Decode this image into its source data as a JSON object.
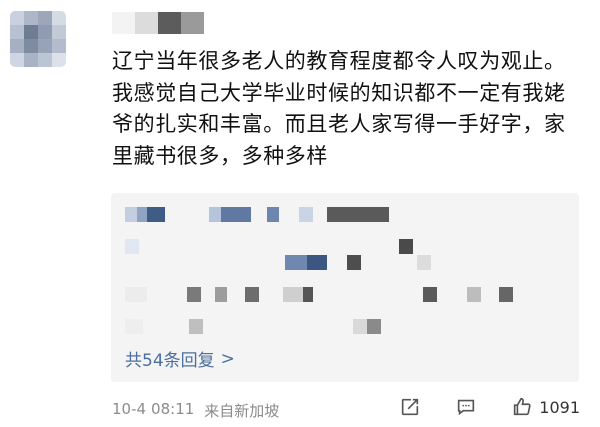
{
  "comment": {
    "text": "辽宁当年很多老人的教育程度都令人叹为观止。我感觉自己大学毕业时候的知识都不一定有我姥爷的扎实和丰富。而且老人家写得一手好字，家里藏书很多，多种多样"
  },
  "replies": {
    "summary": "共54条回复",
    "chevron": ">"
  },
  "footer": {
    "date": "10-4",
    "time": "08:11",
    "location": "来自新加坡",
    "like_count": "1091"
  },
  "icons": {
    "edit": "edit-icon",
    "comment": "comment-icon",
    "like": "thumbs-up-icon"
  },
  "colors": {
    "link": "#4b6fa0",
    "meta": "#8c8c8c",
    "reply_bg": "#f4f4f4"
  }
}
